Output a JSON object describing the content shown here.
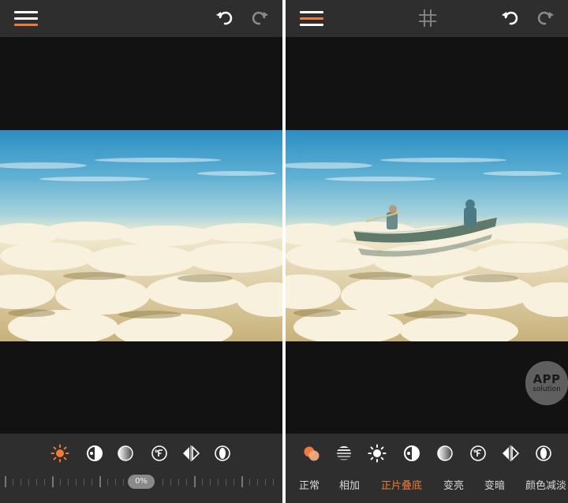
{
  "left_screen": {
    "adjustment_value": "0%",
    "tools": [
      {
        "name": "brightness-icon",
        "active": true
      },
      {
        "name": "contrast-icon",
        "active": false
      },
      {
        "name": "gradient-circle-icon",
        "active": false
      },
      {
        "name": "temperature-icon",
        "active": false
      },
      {
        "name": "mirror-icon",
        "active": false
      },
      {
        "name": "vignette-icon",
        "active": false
      }
    ]
  },
  "right_screen": {
    "tools": [
      {
        "name": "blend-layers-icon",
        "active": true
      },
      {
        "name": "texture-icon",
        "active": false
      },
      {
        "name": "brightness-icon",
        "active": false
      },
      {
        "name": "contrast-icon",
        "active": false
      },
      {
        "name": "gradient-circle-icon",
        "active": false
      },
      {
        "name": "temperature-icon",
        "active": false
      },
      {
        "name": "mirror-icon",
        "active": false
      },
      {
        "name": "vignette-icon",
        "active": false
      }
    ],
    "blend_modes": [
      {
        "label": "正常",
        "active": false
      },
      {
        "label": "相加",
        "active": false
      },
      {
        "label": "正片叠底",
        "active": true
      },
      {
        "label": "变亮",
        "active": false
      },
      {
        "label": "变暗",
        "active": false
      },
      {
        "label": "颜色减淡",
        "active": false
      }
    ]
  },
  "watermark": {
    "line1": "APP",
    "line2": "solution"
  },
  "colors": {
    "accent": "#f07a3a",
    "bar": "#2e2e2e",
    "canvas": "#121212",
    "icon": "#ffffff"
  }
}
